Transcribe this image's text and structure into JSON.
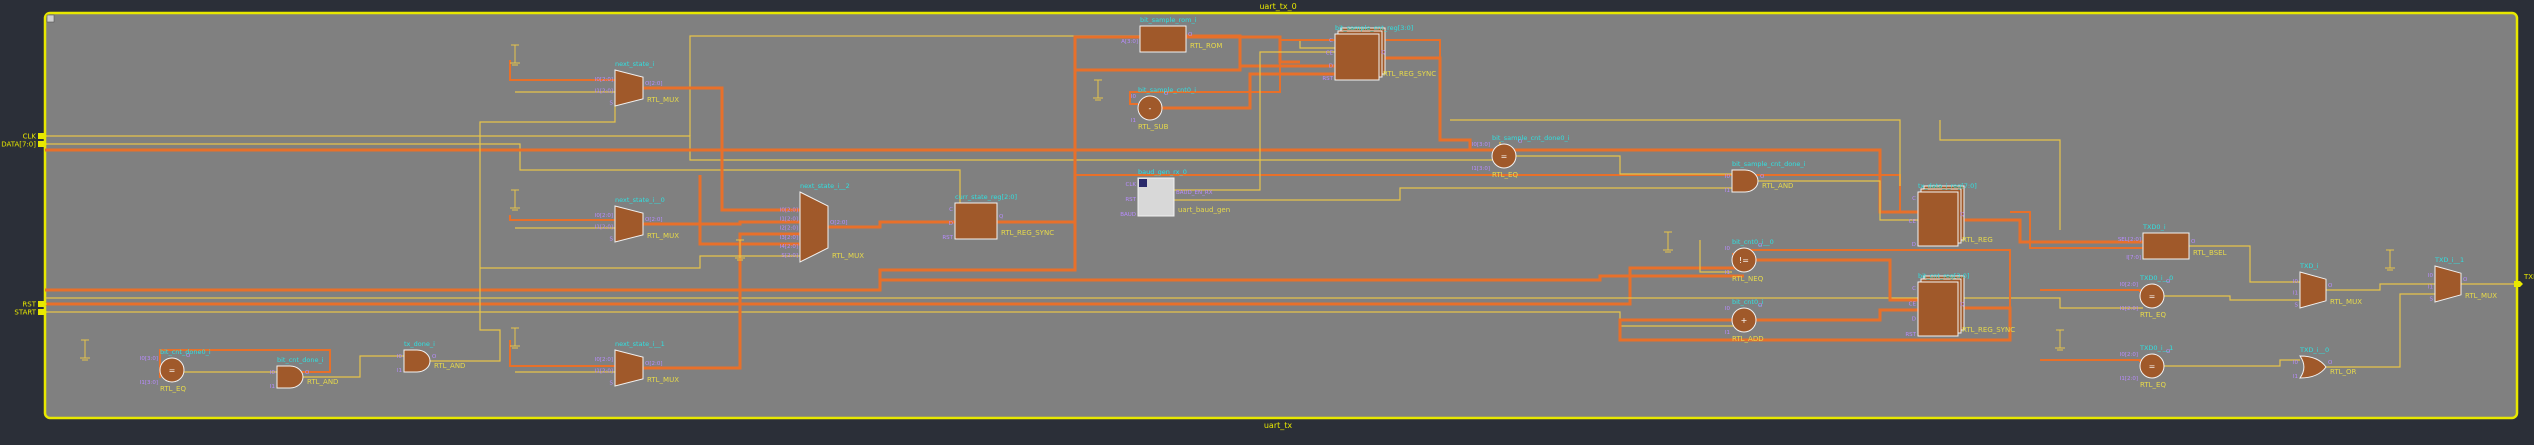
{
  "schematic": {
    "top_title": "uart_tx_0",
    "bottom_title": "uart_tx",
    "colors": {
      "background": "#2b2f38",
      "canvas": "#808080",
      "border": "#e8e800",
      "bus_wire": "#e8702a",
      "net_wire": "#e6c44a",
      "cell_fill": "#a0592a",
      "instance_name": "#2fe0e0",
      "cell_type": "#e6d94a"
    },
    "ports": {
      "inputs": [
        "CLK",
        "DATA[7:0]",
        "RST",
        "START"
      ],
      "outputs": [
        "TXD"
      ]
    },
    "cells": [
      {
        "id": "mux_a",
        "instance": "next_state_i",
        "type": "RTL_MUX",
        "pins": [
          "I0[2:0]",
          "I1[2:0]",
          "S"
        ],
        "out": "O[2:0]",
        "shape": "mux"
      },
      {
        "id": "mux_b",
        "instance": "next_state_i__0",
        "type": "RTL_MUX",
        "pins": [
          "I0[2:0]",
          "I1[2:0]",
          "S"
        ],
        "out": "O[2:0]",
        "shape": "mux"
      },
      {
        "id": "mux_c",
        "instance": "next_state_i__1",
        "type": "RTL_MUX",
        "pins": [
          "I0[2:0]",
          "I1[2:0]",
          "S"
        ],
        "out": "O[2:0]",
        "shape": "mux"
      },
      {
        "id": "mux_d",
        "instance": "next_state_i__2",
        "type": "RTL_MUX",
        "pins": [
          "I0[2:0]",
          "I1[2:0]",
          "I2[2:0]",
          "I3[2:0]",
          "I4[2:0]",
          "S[2:0]"
        ],
        "out": "O[2:0]",
        "shape": "mux"
      },
      {
        "id": "reg_state",
        "instance": "curr_state_reg[2:0]",
        "type": "RTL_REG_SYNC",
        "pins": [
          "C",
          "D",
          "RST"
        ],
        "out": "Q",
        "shape": "reg"
      },
      {
        "id": "rom",
        "instance": "bit_sample_rom_i",
        "type": "RTL_ROM",
        "pins": [
          "A[3:0]"
        ],
        "out": "O",
        "shape": "rom"
      },
      {
        "id": "reg_sample",
        "instance": "bit_sample_cnt_reg[3:0]",
        "type": "RTL_REG_SYNC",
        "pins": [
          "C",
          "CE",
          "D",
          "RST"
        ],
        "out": "Q",
        "shape": "regstack"
      },
      {
        "id": "sub",
        "instance": "bit_sample_cnt0_i",
        "type": "RTL_SUB",
        "pins": [
          "I0",
          "I1"
        ],
        "out": "O",
        "shape": "circle",
        "symbol": "-"
      },
      {
        "id": "eq_sample",
        "instance": "bit_sample_cnt_done0_i",
        "type": "RTL_EQ",
        "pins": [
          "I0[3:0]",
          "I1[3:0]"
        ],
        "out": "O",
        "shape": "circle",
        "symbol": "="
      },
      {
        "id": "and_sample",
        "instance": "bit_sample_cnt_done_i",
        "type": "RTL_AND",
        "pins": [
          "I0",
          "I1"
        ],
        "out": "O",
        "shape": "and"
      },
      {
        "id": "baud",
        "instance": "baud_gen_rx_0",
        "type": "uart_baud_gen",
        "pins": [
          "CLK",
          "RST",
          "BAUD"
        ],
        "out": "BAUD_EN_RX",
        "shape": "block"
      },
      {
        "id": "eq_left",
        "instance": "bit_cnt_done0_i",
        "type": "RTL_EQ",
        "pins": [
          "I0[3:0]",
          "I1[3:0]"
        ],
        "out": "O",
        "shape": "circle",
        "symbol": "="
      },
      {
        "id": "and_left",
        "instance": "bit_cnt_done_i",
        "type": "RTL_AND",
        "pins": [
          "I0",
          "I1"
        ],
        "out": "O",
        "shape": "and"
      },
      {
        "id": "and_mid",
        "instance": "tx_done_i",
        "type": "RTL_AND",
        "pins": [
          "I0",
          "I1"
        ],
        "out": "O",
        "shape": "and"
      },
      {
        "id": "reg_data",
        "instance": "tx_data_i_reg[7:0]",
        "type": "RTL_REG",
        "pins": [
          "C",
          "CE",
          "D"
        ],
        "out": "Q",
        "shape": "regstack"
      },
      {
        "id": "neq",
        "instance": "bit_cnt0_i__0",
        "type": "RTL_NEQ",
        "pins": [
          "I0",
          "I1"
        ],
        "out": "O",
        "shape": "circle",
        "symbol": "!="
      },
      {
        "id": "add",
        "instance": "bit_cnt0_i",
        "type": "RTL_ADD",
        "pins": [
          "I0",
          "I1"
        ],
        "out": "O",
        "shape": "circle",
        "symbol": "+"
      },
      {
        "id": "reg_cnt",
        "instance": "bit_cnt_reg[3:0]",
        "type": "RTL_REG_SYNC",
        "pins": [
          "C",
          "CE",
          "D",
          "RST"
        ],
        "out": "Q",
        "shape": "regstack"
      },
      {
        "id": "bsel",
        "instance": "TXD0_i",
        "type": "RTL_BSEL",
        "pins": [
          "SEL[2:0]",
          "I[7:0]"
        ],
        "out": "O",
        "shape": "reg"
      },
      {
        "id": "eq_r1",
        "instance": "TXD0_i__0",
        "type": "RTL_EQ",
        "pins": [
          "I0[2:0]",
          "I1[2:0]"
        ],
        "out": "O",
        "shape": "circle",
        "symbol": "="
      },
      {
        "id": "eq_r2",
        "instance": "TXD0_i__1",
        "type": "RTL_EQ",
        "pins": [
          "I0[2:0]",
          "I1[2:0]"
        ],
        "out": "O",
        "shape": "circle",
        "symbol": "="
      },
      {
        "id": "mux_r1",
        "instance": "TXD_i",
        "type": "RTL_MUX",
        "pins": [
          "I0",
          "I1",
          "S"
        ],
        "out": "O",
        "shape": "mux"
      },
      {
        "id": "or_r",
        "instance": "TXD_i__0",
        "type": "RTL_OR",
        "pins": [
          "I0",
          "I1"
        ],
        "out": "O",
        "shape": "or"
      },
      {
        "id": "mux_r2",
        "instance": "TXD_i__1",
        "type": "RTL_MUX",
        "pins": [
          "I0",
          "I1",
          "S"
        ],
        "out": "O",
        "shape": "mux"
      }
    ]
  }
}
